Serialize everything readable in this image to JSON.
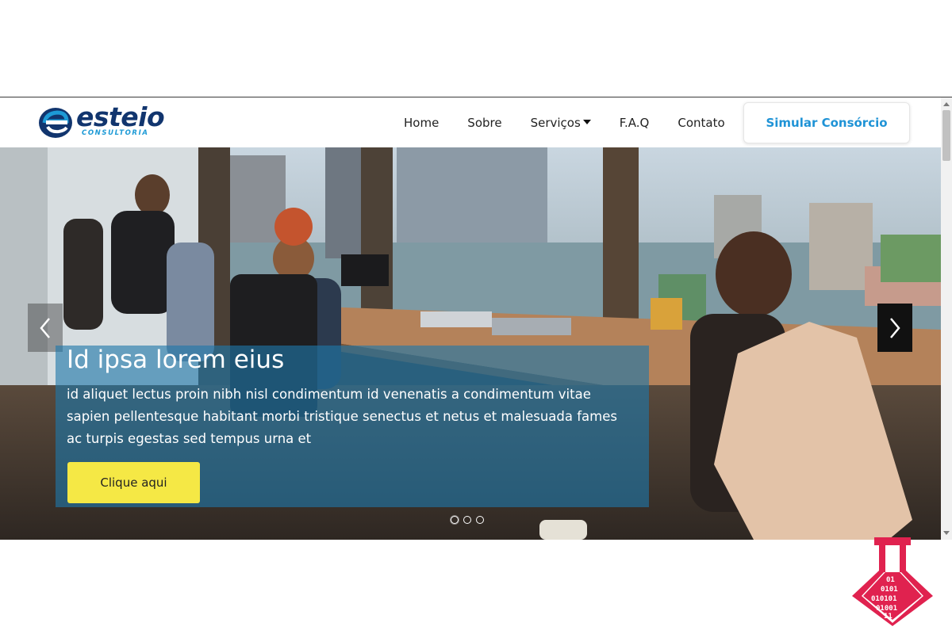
{
  "logo": {
    "name": "esteio",
    "subtitle": "CONSULTORIA"
  },
  "nav": {
    "items": [
      {
        "label": "Home"
      },
      {
        "label": "Sobre"
      },
      {
        "label": "Serviços"
      },
      {
        "label": "F.A.Q"
      },
      {
        "label": "Contato"
      }
    ],
    "cta_label": "Simular Consórcio"
  },
  "hero": {
    "title": "Id ipsa lorem eius",
    "text": "id aliquet lectus proin nibh nisl condimentum id venenatis a condimentum vitae sapien pellentesque habitant morbi tristique senectus et netus et malesuada fames ac turpis egestas sed tempus urna et",
    "button_label": "Clique aqui",
    "slides": 3,
    "active_slide": 1
  },
  "colors": {
    "brand_navy": "#11356e",
    "brand_blue": "#1f93d6",
    "cta_yellow": "#f5e845",
    "watermark_red": "#e0224f"
  },
  "icons": [
    "chevron-left-icon",
    "chevron-right-icon",
    "caret-down-icon",
    "logo-e-icon",
    "flask-binary-icon"
  ]
}
